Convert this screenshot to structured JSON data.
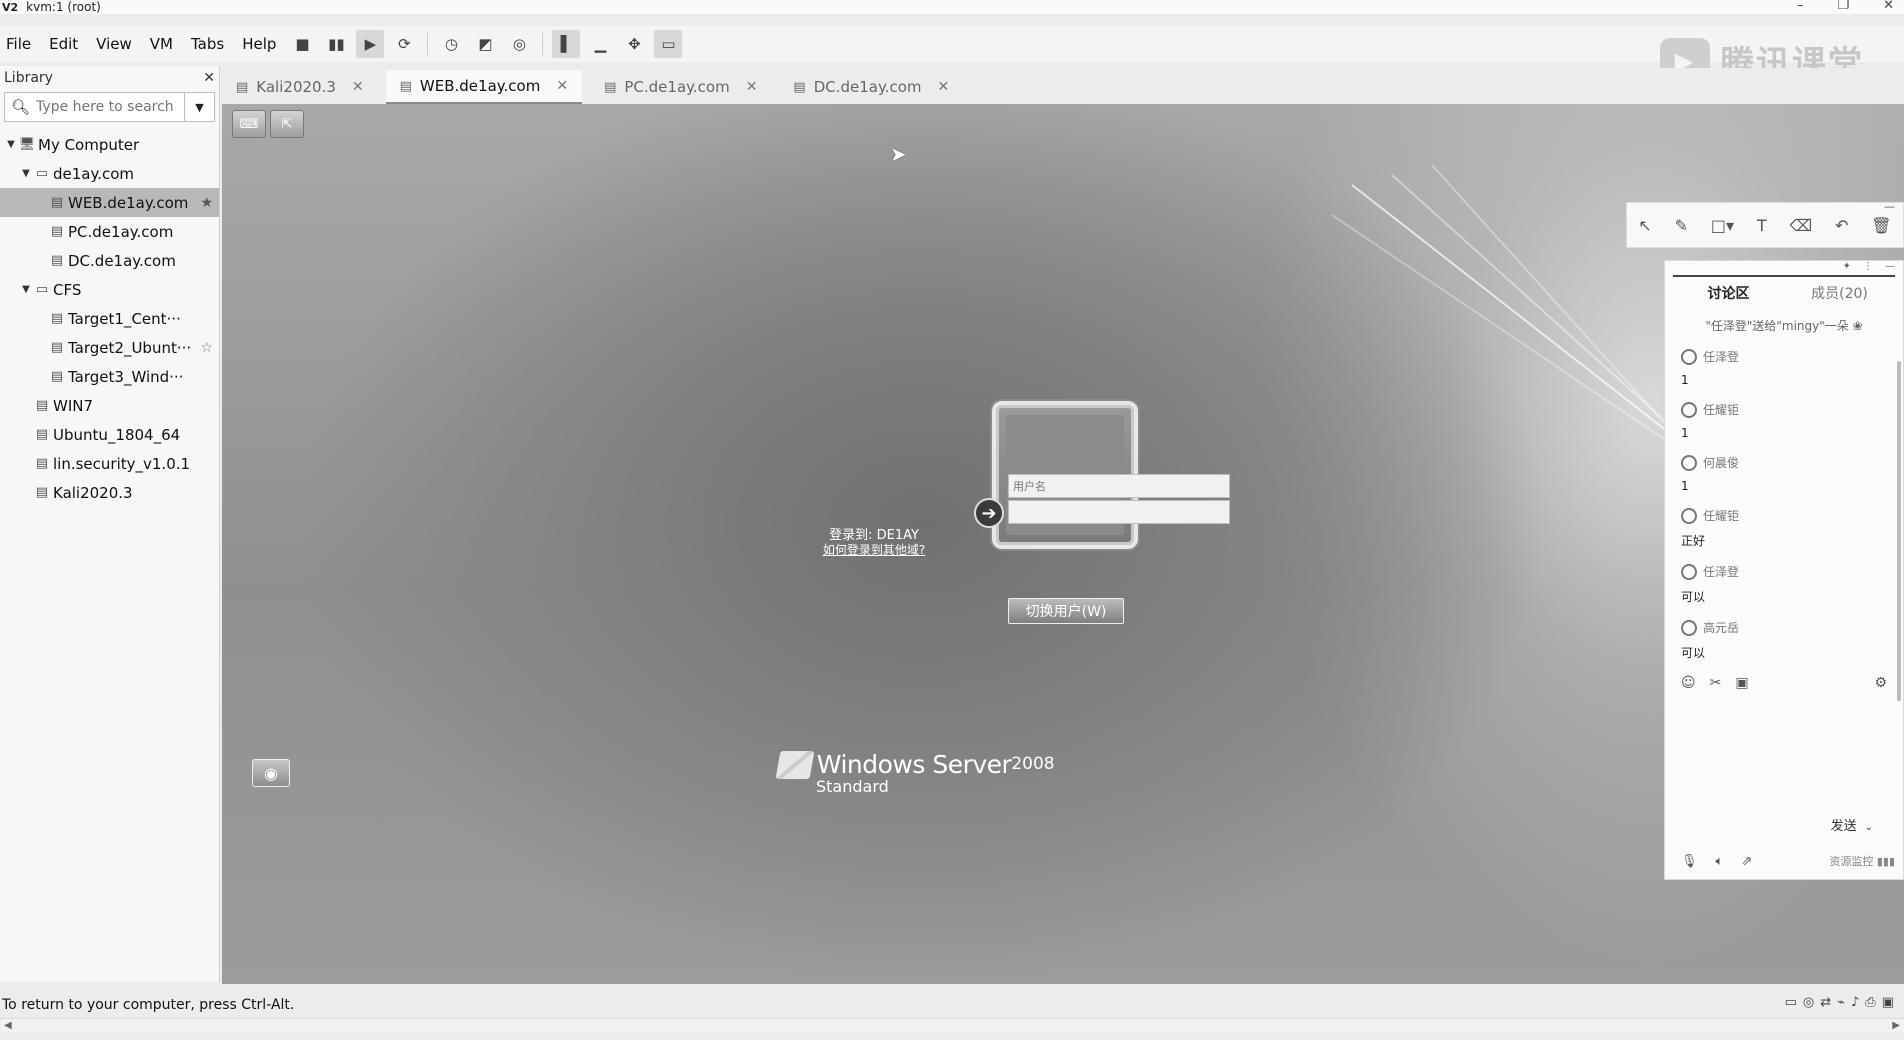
{
  "window": {
    "app_icon": "V2",
    "title": "kvm:1 (root)",
    "controls": [
      "–",
      "❐",
      "✕"
    ]
  },
  "menu": {
    "items": [
      "File",
      "Edit",
      "View",
      "VM",
      "Tabs",
      "Help"
    ]
  },
  "watermark": {
    "text": "腾讯课堂"
  },
  "library": {
    "title": "Library",
    "search_placeholder": "Type here to search",
    "tree": [
      {
        "label": "My Computer",
        "indent": 0,
        "expanded": true
      },
      {
        "label": "de1ay.com",
        "indent": 1,
        "expanded": true
      },
      {
        "label": "WEB.de1ay.com",
        "indent": 2,
        "selected": true,
        "star": "filled"
      },
      {
        "label": "PC.de1ay.com",
        "indent": 2
      },
      {
        "label": "DC.de1ay.com",
        "indent": 2
      },
      {
        "label": "CFS",
        "indent": 1,
        "expanded": true
      },
      {
        "label": "Target1_Cent···",
        "indent": 2
      },
      {
        "label": "Target2_Ubunt···",
        "indent": 2,
        "star": "outline"
      },
      {
        "label": "Target3_Wind···",
        "indent": 2
      },
      {
        "label": "WIN7",
        "indent": 1
      },
      {
        "label": "Ubuntu_1804_64",
        "indent": 1
      },
      {
        "label": "lin.security_v1.0.1",
        "indent": 1
      },
      {
        "label": "Kali2020.3",
        "indent": 1
      }
    ]
  },
  "tabs": [
    {
      "label": "Kali2020.3",
      "active": false
    },
    {
      "label": "WEB.de1ay.com",
      "active": true
    },
    {
      "label": "PC.de1ay.com",
      "active": false
    },
    {
      "label": "DC.de1ay.com",
      "active": false
    }
  ],
  "login": {
    "username_placeholder": "用户名",
    "password_value": "",
    "login_to": "登录到: DE1AY",
    "other_domain_link": "如何登录到其他域?",
    "switch_user": "切换用户(W)"
  },
  "os_brand": {
    "name": "Windows Server",
    "version": "2008",
    "edition": "Standard"
  },
  "chat": {
    "tabs": [
      "讨论区",
      "成员(20)"
    ],
    "notice": "\"任泽登\"送给\"mingy\"一朵",
    "messages": [
      {
        "sender": "任泽登",
        "text": "1"
      },
      {
        "sender": "任耀钜",
        "text": "1"
      },
      {
        "sender": "何晨俊",
        "text": "1"
      },
      {
        "sender": "任耀钜",
        "text": "正好"
      },
      {
        "sender": "任泽登",
        "text": "可以"
      },
      {
        "sender": "高元岳",
        "text": "可以"
      }
    ],
    "send_label": "发送",
    "monitor_label": "资源监控"
  },
  "status": {
    "message": "To return to your computer, press Ctrl-Alt."
  }
}
